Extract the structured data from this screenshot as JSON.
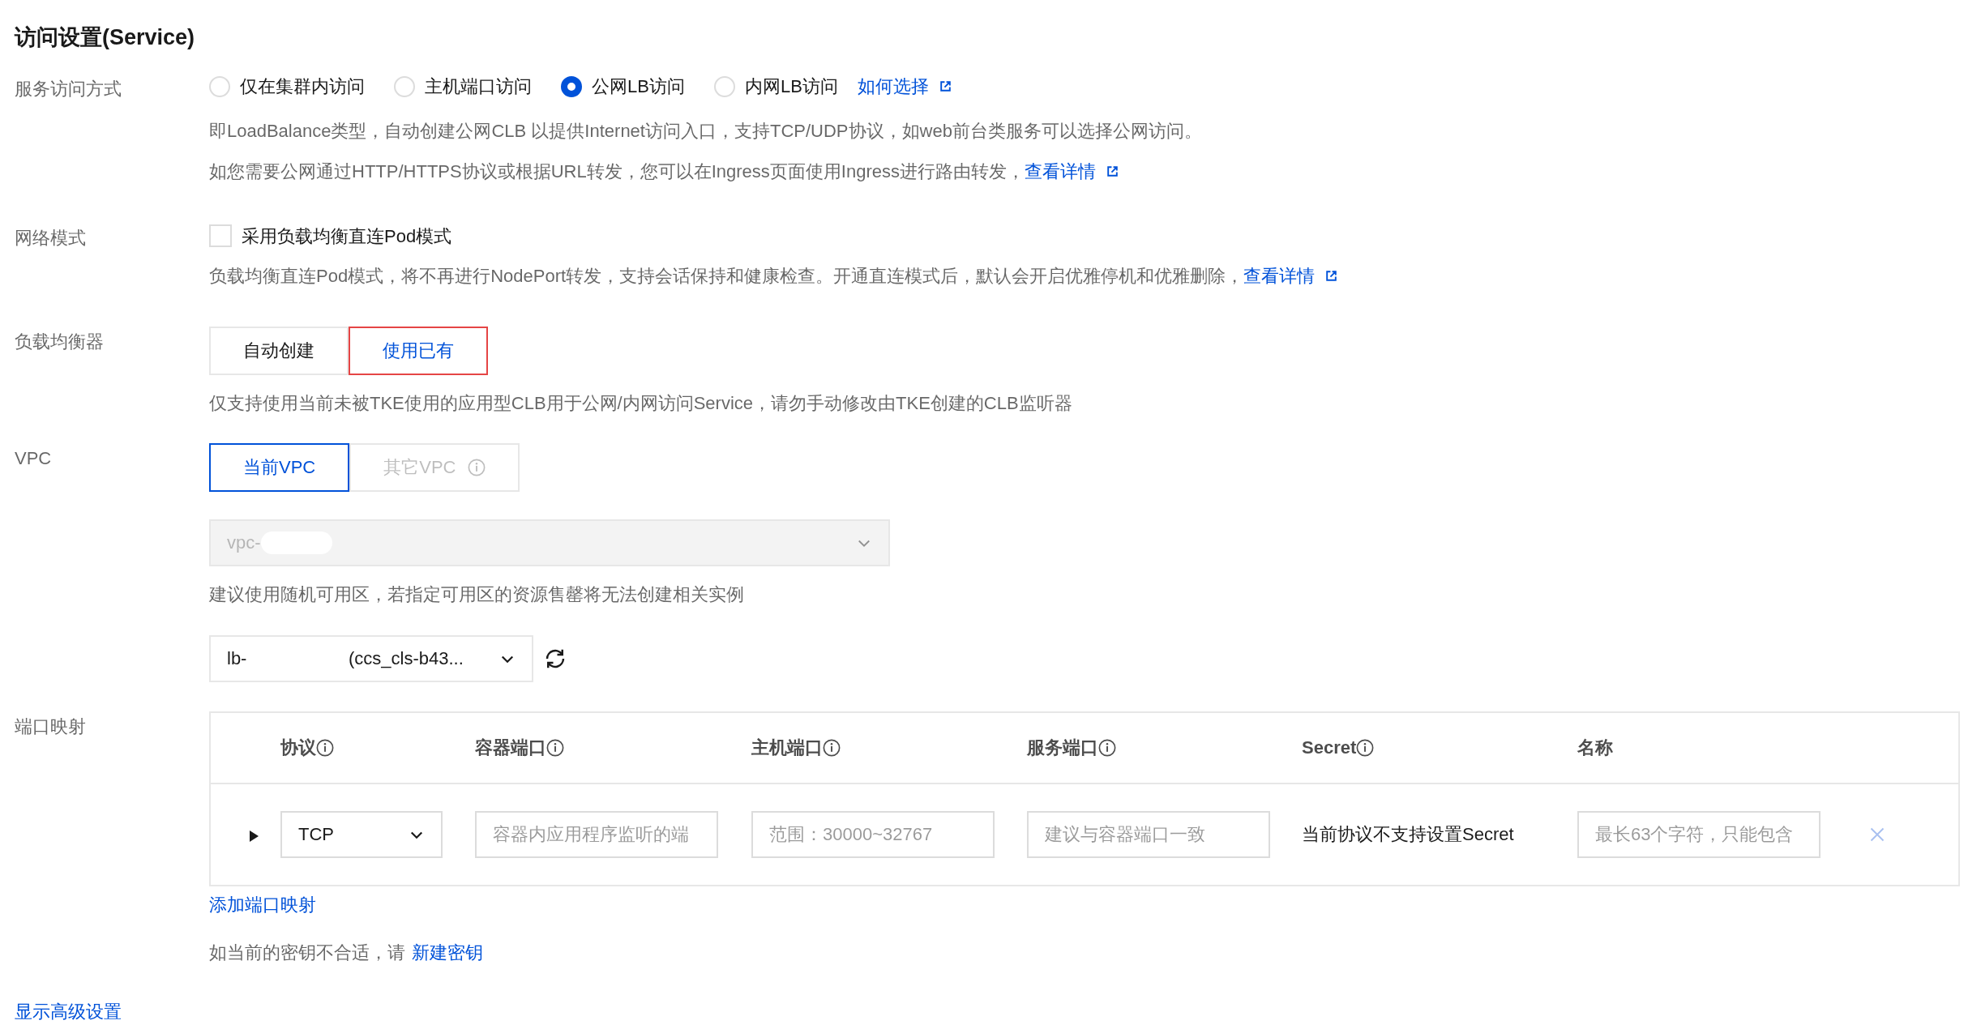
{
  "title": "访问设置(Service)",
  "access": {
    "label": "服务访问方式",
    "options": [
      {
        "label": "仅在集群内访问",
        "selected": false
      },
      {
        "label": "主机端口访问",
        "selected": false
      },
      {
        "label": "公网LB访问",
        "selected": true
      },
      {
        "label": "内网LB访问",
        "selected": false
      }
    ],
    "help_link": "如何选择",
    "descriptions": [
      {
        "text": "即LoadBalance类型，自动创建公网CLB 以提供Internet访问入口，支持TCP/UDP协议，如web前台类服务可以选择公网访问。"
      },
      {
        "text": "如您需要公网通过HTTP/HTTPS协议或根据URL转发，您可以在Ingress页面使用Ingress进行路由转发，",
        "link": "查看详情"
      }
    ]
  },
  "network": {
    "label": "网络模式",
    "checkbox": {
      "label": "采用负载均衡直连Pod模式",
      "checked": false
    },
    "description": {
      "text": "负载均衡直连Pod模式，将不再进行NodePort转发，支持会话保持和健康检查。开通直连模式后，默认会开启优雅停机和优雅删除，",
      "link": "查看详情"
    }
  },
  "load_balancer": {
    "label": "负载均衡器",
    "tabs": [
      {
        "label": "自动创建",
        "selected": false
      },
      {
        "label": "使用已有",
        "selected": true
      }
    ],
    "description": "仅支持使用当前未被TKE使用的应用型CLB用于公网/内网访问Service，请勿手动修改由TKE创建的CLB监听器"
  },
  "vpc": {
    "label": "VPC",
    "tabs": [
      {
        "label": "当前VPC",
        "selected": true,
        "disabled": false,
        "info": false
      },
      {
        "label": "其它VPC",
        "selected": false,
        "disabled": true,
        "info": true
      }
    ],
    "select": {
      "value": "vpc-",
      "disabled": true
    },
    "hint": "建议使用随机可用区，若指定可用区的资源售罄将无法创建相关实例",
    "lb_select": {
      "value_start": "lb-",
      "value_end": "(ccs_cls-b43..."
    }
  },
  "port_mapping": {
    "label": "端口映射",
    "columns": [
      {
        "label": "协议",
        "info": true
      },
      {
        "label": "容器端口",
        "info": true
      },
      {
        "label": "主机端口",
        "info": true
      },
      {
        "label": "服务端口",
        "info": true
      },
      {
        "label": "Secret",
        "info": true
      },
      {
        "label": "名称",
        "info": false
      }
    ],
    "rows": [
      {
        "protocol": "TCP",
        "container_port": {
          "placeholder": "容器内应用程序监听的端"
        },
        "host_port": {
          "placeholder": "范围：30000~32767"
        },
        "service_port": {
          "placeholder": "建议与容器端口一致"
        },
        "secret": "当前协议不支持设置Secret",
        "name": {
          "placeholder": "最长63个字符，只能包含"
        }
      }
    ],
    "add_link": "添加端口映射",
    "secret_hint": {
      "text": "如当前的密钥不合适，请",
      "link": "新建密钥"
    }
  },
  "advanced_link": "显示高级设置"
}
